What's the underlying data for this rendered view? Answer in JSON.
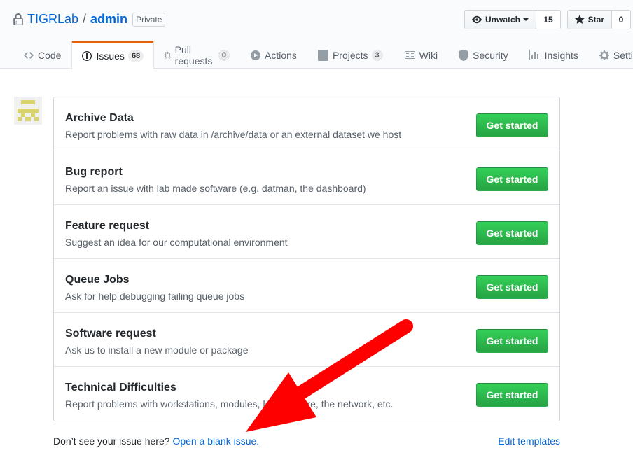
{
  "repo": {
    "owner": "TIGRLab",
    "separator": "/",
    "name": "admin",
    "visibility": "Private"
  },
  "header_actions": {
    "watch": {
      "label": "Unwatch",
      "count": "15"
    },
    "star": {
      "label": "Star",
      "count": "0"
    }
  },
  "tabs": [
    {
      "label": "Code",
      "icon": "code-icon"
    },
    {
      "label": "Issues",
      "count": "68",
      "icon": "issue-opened-icon",
      "selected": true
    },
    {
      "label": "Pull requests",
      "count": "0",
      "icon": "git-pull-request-icon"
    },
    {
      "label": "Actions",
      "icon": "play-icon"
    },
    {
      "label": "Projects",
      "count": "3",
      "icon": "project-icon"
    },
    {
      "label": "Wiki",
      "icon": "book-icon"
    },
    {
      "label": "Security",
      "icon": "shield-icon"
    },
    {
      "label": "Insights",
      "icon": "graph-icon"
    },
    {
      "label": "Settings",
      "icon": "gear-icon"
    }
  ],
  "templates": [
    {
      "name": "Archive Data",
      "description": "Report problems with raw data in /archive/data or an external dataset we host",
      "button": "Get started"
    },
    {
      "name": "Bug report",
      "description": "Report an issue with lab made software (e.g. datman, the dashboard)",
      "button": "Get started"
    },
    {
      "name": "Feature request",
      "description": "Suggest an idea for our computational environment",
      "button": "Get started"
    },
    {
      "name": "Queue Jobs",
      "description": "Ask for help debugging failing queue jobs",
      "button": "Get started"
    },
    {
      "name": "Software request",
      "description": "Ask us to install a new module or package",
      "button": "Get started"
    },
    {
      "name": "Technical Difficulties",
      "description": "Report problems with workstations, modules, lab software, the network, etc.",
      "button": "Get started"
    }
  ],
  "footer": {
    "prompt": "Don’t see your issue here? ",
    "blank_issue_link": "Open a blank issue.",
    "edit_templates": "Edit templates"
  },
  "colors": {
    "link": "#0366d6",
    "primary_button": "#28a745",
    "selected_tab_accent": "#e36209",
    "annotation_arrow": "#ff0000"
  }
}
